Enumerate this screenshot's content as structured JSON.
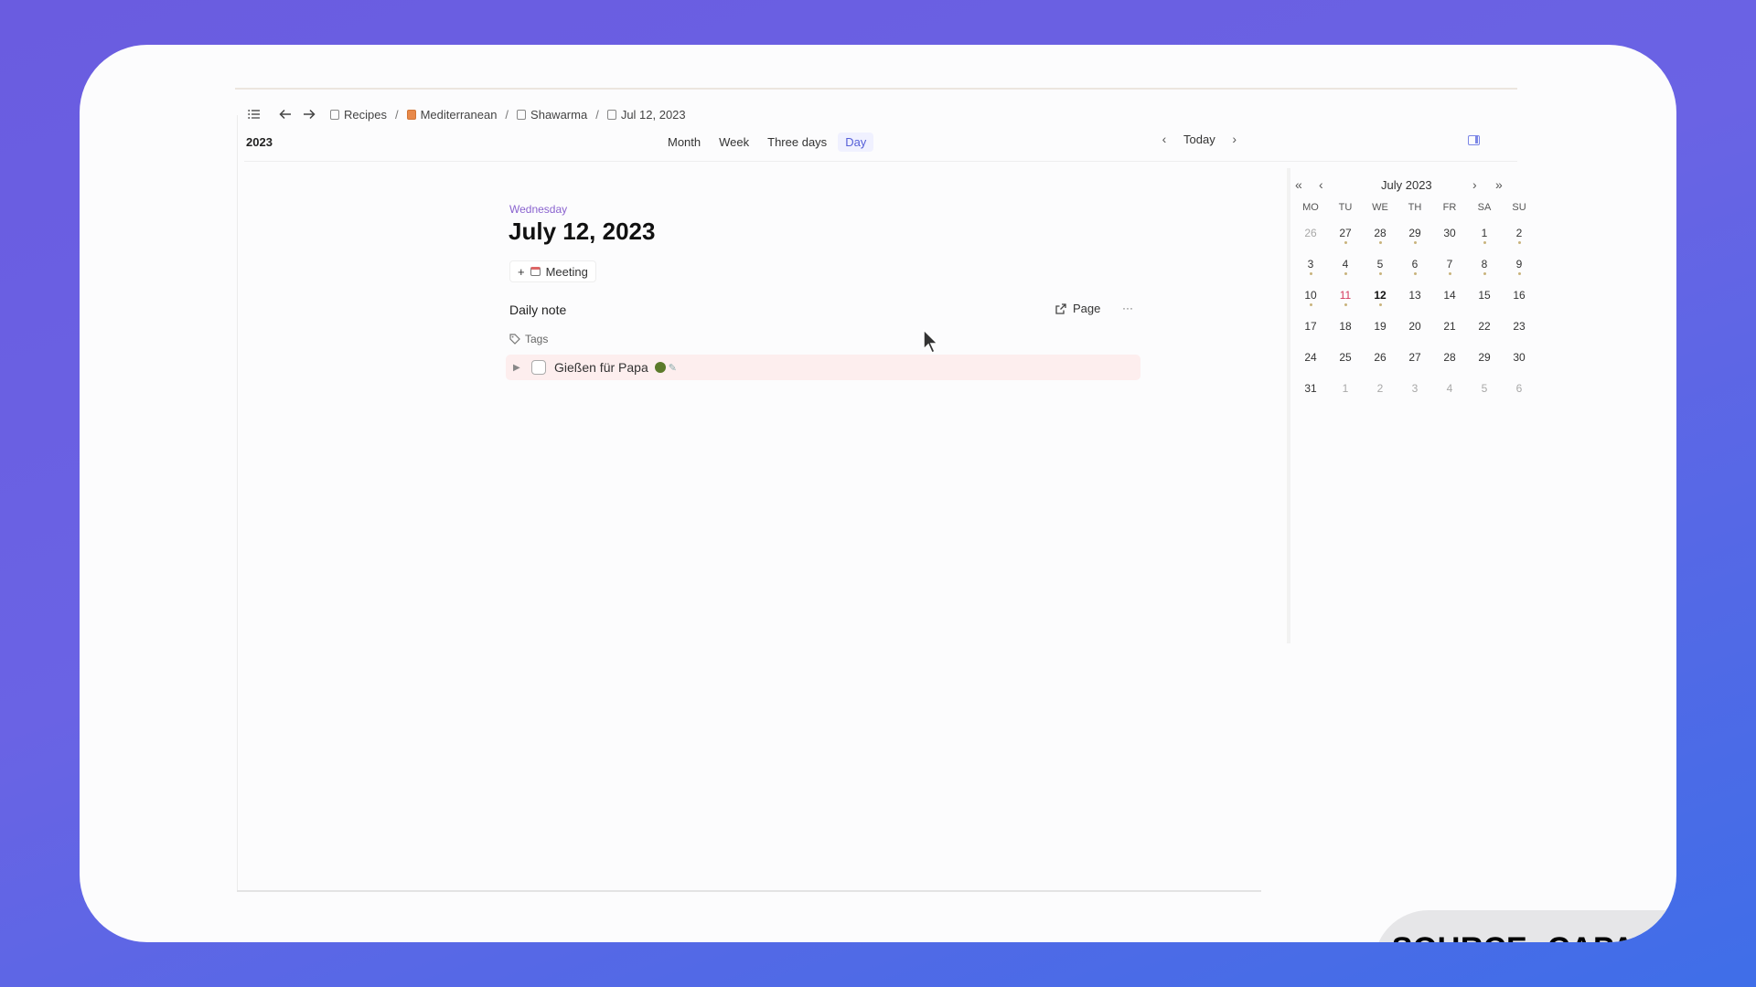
{
  "breadcrumb": {
    "items": [
      {
        "label": "Recipes",
        "icon": "page-icon"
      },
      {
        "label": "Mediterranean",
        "icon": "collection-icon"
      },
      {
        "label": "Shawarma",
        "icon": "page-icon"
      },
      {
        "label": "Jul 12, 2023",
        "icon": "calendar-icon"
      }
    ],
    "separator": "/"
  },
  "viewbar": {
    "year": "2023",
    "tabs": [
      "Month",
      "Week",
      "Three days",
      "Day"
    ],
    "active_tab": "Day",
    "today_label": "Today"
  },
  "main": {
    "weekday": "Wednesday",
    "date_title": "July 12, 2023",
    "meeting_label": "Meeting",
    "daily_note_label": "Daily note",
    "page_label": "Page",
    "more_label": "···",
    "tags_label": "Tags",
    "todo": {
      "text": "Gießen für Papa",
      "checked": false,
      "highlight_color": "#fdeeee"
    }
  },
  "calendar": {
    "title": "July 2023",
    "weekdays": [
      "MO",
      "TU",
      "WE",
      "TH",
      "FR",
      "SA",
      "SU"
    ],
    "weeks": [
      [
        "26",
        "27",
        "28",
        "29",
        "30",
        "1",
        "2"
      ],
      [
        "3",
        "4",
        "5",
        "6",
        "7",
        "8",
        "9"
      ],
      [
        "10",
        "11",
        "12",
        "13",
        "14",
        "15",
        "16"
      ],
      [
        "17",
        "18",
        "19",
        "20",
        "21",
        "22",
        "23"
      ],
      [
        "24",
        "25",
        "26",
        "27",
        "28",
        "29",
        "30"
      ],
      [
        "31",
        "1",
        "2",
        "3",
        "4",
        "5",
        "6"
      ]
    ],
    "today": "11",
    "selected": "12",
    "accent_today": "#d53b5e"
  },
  "badge": {
    "text": "SOURCE: CAPACITIES"
  },
  "colors": {
    "accent": "#5660d8",
    "weekday_text": "#8a63cf"
  }
}
